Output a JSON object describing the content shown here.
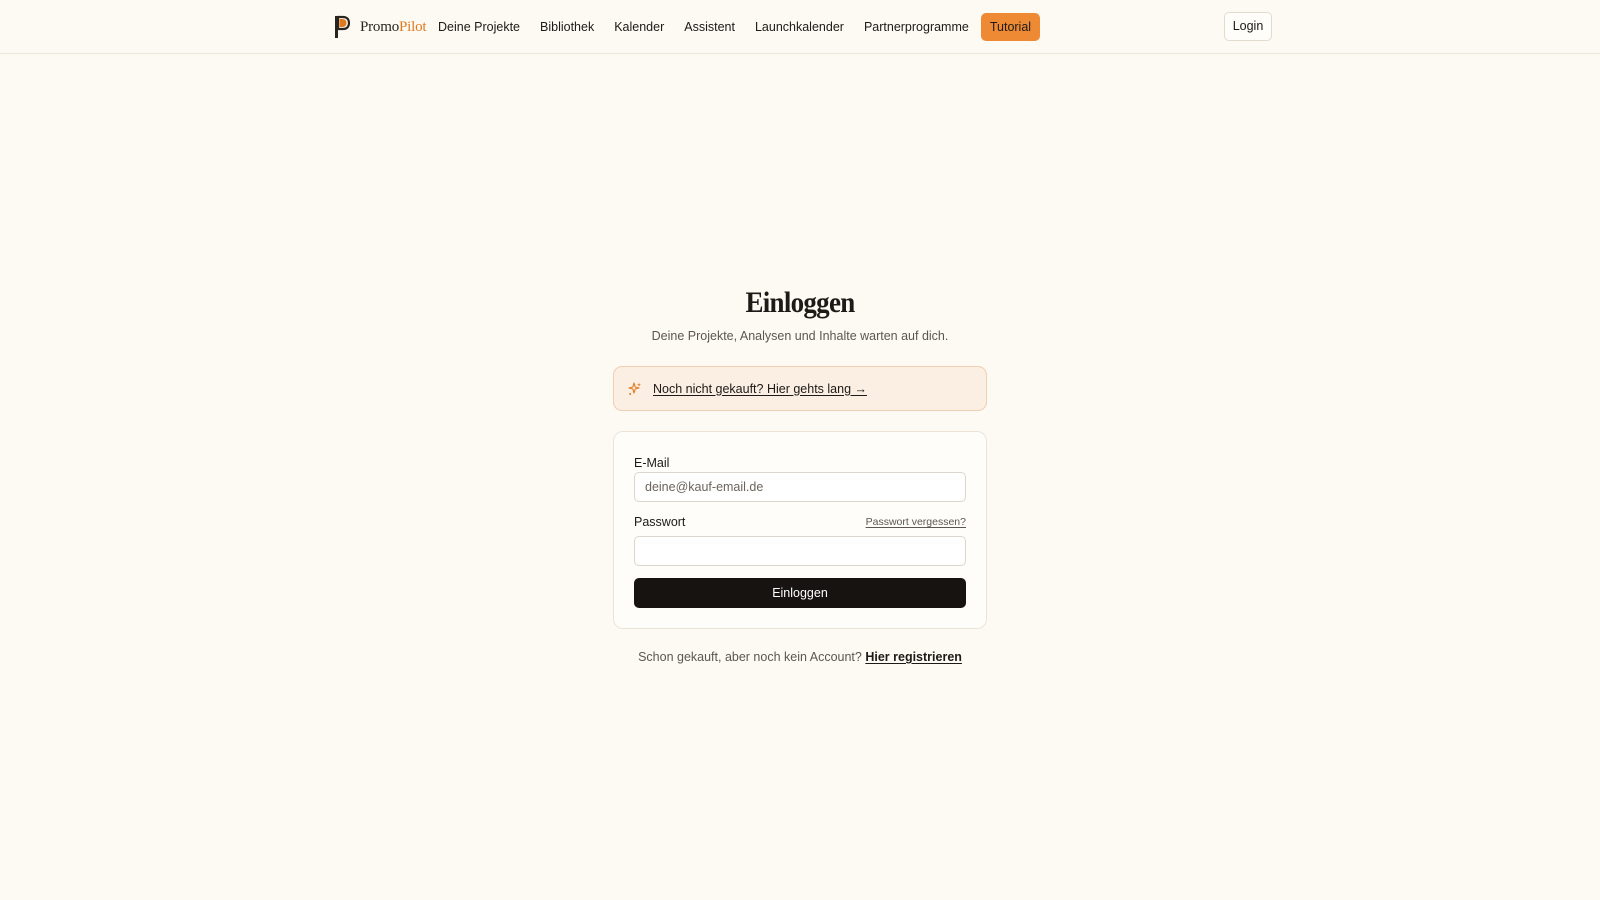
{
  "header": {
    "brand": {
      "name_part1": "Promo",
      "name_part2": "Pilot",
      "accent_color": "#e07a1f"
    },
    "nav": [
      {
        "label": "Deine Projekte"
      },
      {
        "label": "Bibliothek"
      },
      {
        "label": "Kalender"
      },
      {
        "label": "Assistent"
      },
      {
        "label": "Launchkalender"
      },
      {
        "label": "Partnerprogramme"
      },
      {
        "label": "Tutorial",
        "highlight_color": "#ef8a34"
      }
    ],
    "login_label": "Login"
  },
  "main": {
    "title": "Einloggen",
    "subtitle": "Deine Projekte, Analysen und Inhalte warten auf dich.",
    "promo": {
      "icon": "sparkles-icon",
      "link_text": "Noch nicht gekauft? Hier gehts lang →"
    },
    "form": {
      "email_label": "E-Mail",
      "email_placeholder": "deine@kauf-email.de",
      "email_value": "",
      "password_label": "Passwort",
      "password_value": "",
      "forgot_label": "Passwort vergessen?",
      "submit_label": "Einloggen"
    },
    "register": {
      "prompt": "Schon gekauft, aber noch kein Account?",
      "link_text": "Hier registrieren"
    }
  }
}
